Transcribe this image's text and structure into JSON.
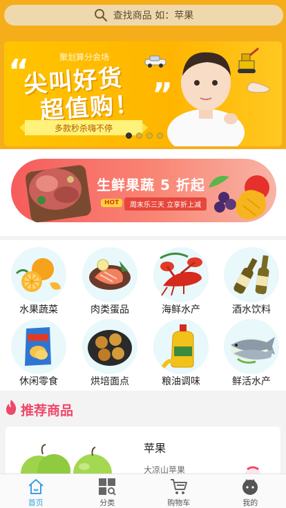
{
  "search": {
    "placeholder": "查找商品 如：苹果"
  },
  "banner": {
    "subtitle": "聚划算分会场",
    "headline_1": "尖叫好货",
    "headline_2": "超值购！",
    "ribbon": "多款秒杀嗨不停",
    "slide_count": 4,
    "active_slide": 1
  },
  "promo": {
    "title": "生鲜果蔬 5 折起",
    "hot_badge": "HOT",
    "desc": "周末乐三天 立享折上减"
  },
  "categories": [
    {
      "label": "水果蔬菜",
      "icon": "orange-icon"
    },
    {
      "label": "肉类蛋品",
      "icon": "salmon-icon"
    },
    {
      "label": "海鲜水产",
      "icon": "lobster-icon"
    },
    {
      "label": "酒水饮料",
      "icon": "beer-icon"
    },
    {
      "label": "休闲零食",
      "icon": "chips-icon"
    },
    {
      "label": "烘培面点",
      "icon": "bread-icon"
    },
    {
      "label": "粮油调味",
      "icon": "oil-bottle-icon"
    },
    {
      "label": "鲜活水产",
      "icon": "fish-icon"
    }
  ],
  "recommend": {
    "title": "推荐商品",
    "product": {
      "name": "苹果",
      "subtitle": "大凉山苹果"
    }
  },
  "tabs": [
    {
      "label": "首页",
      "icon": "home-icon",
      "active": true
    },
    {
      "label": "分类",
      "icon": "category-icon",
      "active": false
    },
    {
      "label": "购物车",
      "icon": "cart-icon",
      "active": false
    },
    {
      "label": "我的",
      "icon": "profile-icon",
      "active": false
    }
  ],
  "colors": {
    "accent": "#f5ae1a",
    "brand_pink": "#f0476a",
    "tab_active": "#3aa0e4"
  }
}
